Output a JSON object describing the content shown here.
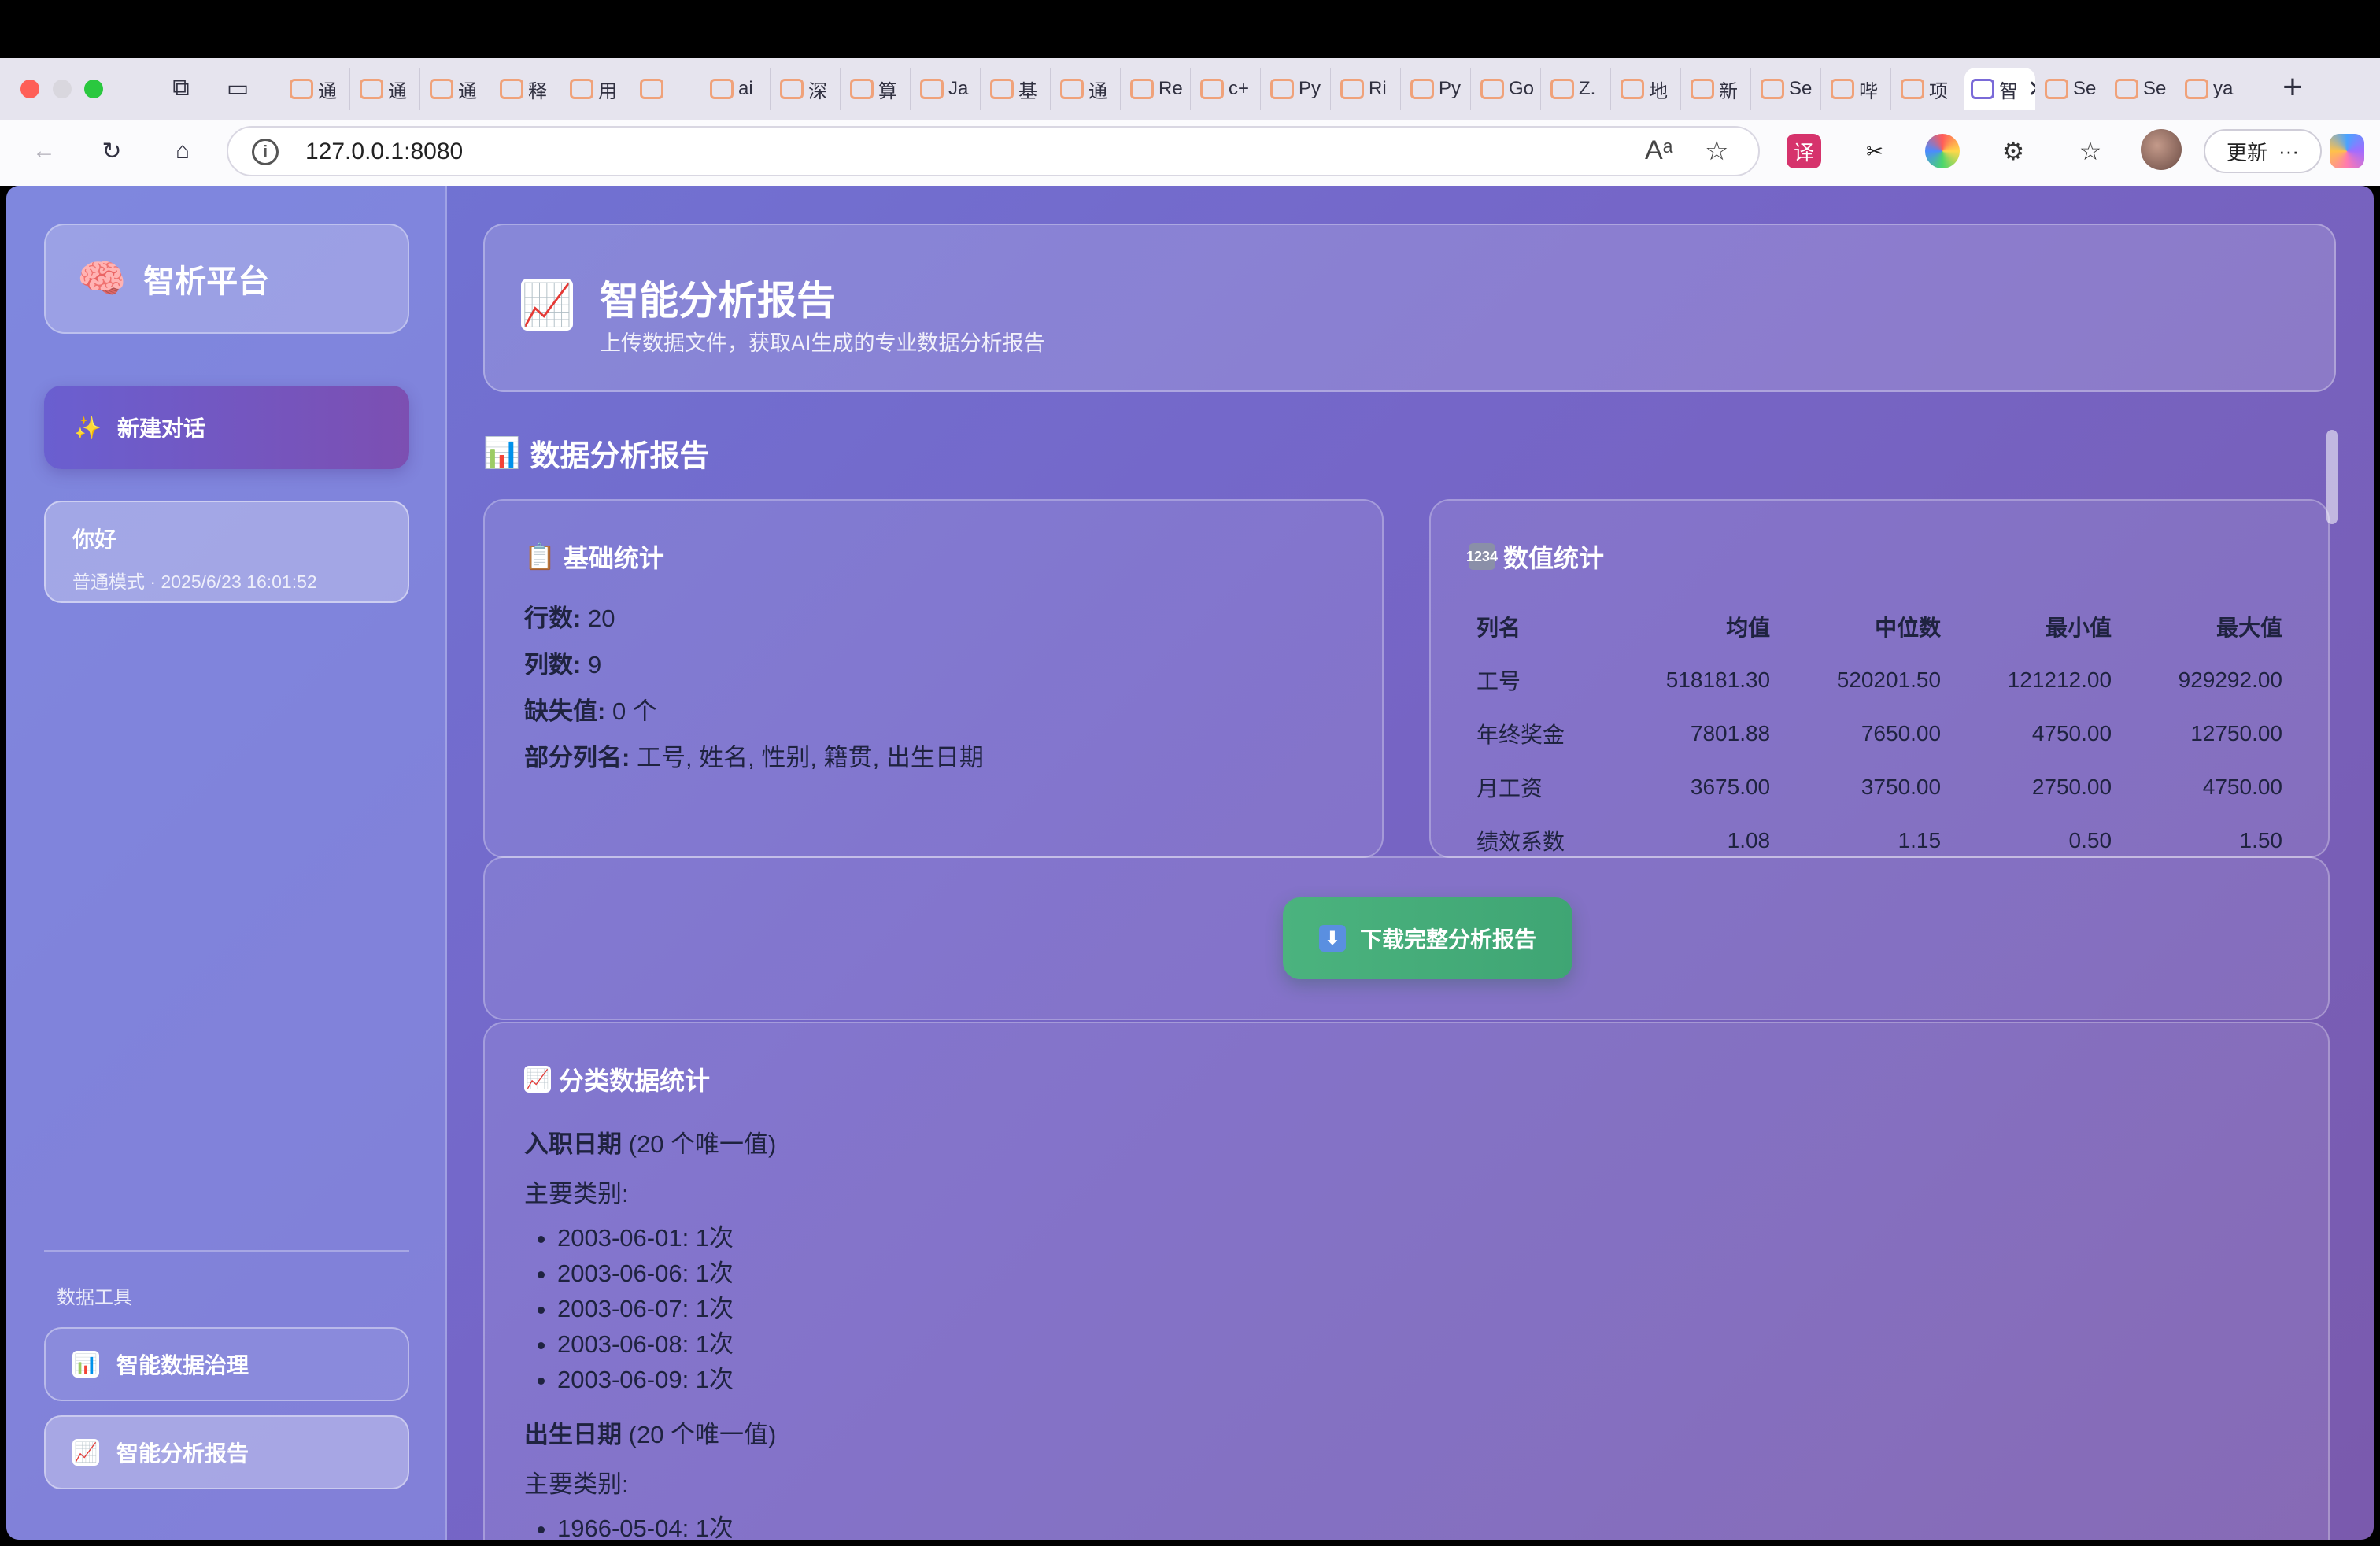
{
  "browser": {
    "tabs": [
      "通",
      "通",
      "通",
      "释",
      "用",
      "",
      "ai",
      "深",
      "算",
      "Ja",
      "基",
      "通",
      "Re",
      "c+",
      "Py",
      "Ri",
      "Py",
      "Go",
      "Z.",
      "地",
      "新",
      "Se",
      "哔",
      "项",
      "智",
      "Se",
      "Se",
      "ya"
    ],
    "active_tab_index": 24,
    "url": "127.0.0.1:8080",
    "update_label": "更新"
  },
  "sidebar": {
    "brand_icon": "brain-emoji",
    "brand_title": "智析平台",
    "new_chat_label": "新建对话",
    "conversations": [
      {
        "title": "你好",
        "meta": "普通模式 · 2025/6/23 16:01:52"
      }
    ],
    "tools_label": "数据工具",
    "tools": [
      {
        "label": "智能数据治理",
        "icon": "bar-chart-icon"
      },
      {
        "label": "智能分析报告",
        "icon": "trend-chart-icon"
      }
    ]
  },
  "header": {
    "title": "智能分析报告",
    "subtitle": "上传数据文件，获取AI生成的专业数据分析报告"
  },
  "report": {
    "section_title": "数据分析报告",
    "basic": {
      "title": "基础统计",
      "rows_label": "行数:",
      "rows_value": "20",
      "cols_label": "列数:",
      "cols_value": "9",
      "missing_label": "缺失值:",
      "missing_value": "0 个",
      "names_label": "部分列名:",
      "names_value": "工号, 姓名, 性别, 籍贯, 出生日期"
    },
    "numeric": {
      "title": "数值统计",
      "headers": [
        "列名",
        "均值",
        "中位数",
        "最小值",
        "最大值"
      ],
      "rows": [
        [
          "工号",
          "518181.30",
          "520201.50",
          "121212.00",
          "929292.00"
        ],
        [
          "年终奖金",
          "7801.88",
          "7650.00",
          "4750.00",
          "12750.00"
        ],
        [
          "月工资",
          "3675.00",
          "3750.00",
          "2750.00",
          "4750.00"
        ],
        [
          "绩效系数",
          "1.08",
          "1.15",
          "0.50",
          "1.50"
        ]
      ]
    },
    "download_label": "下载完整分析报告",
    "categorical": {
      "title": "分类数据统计",
      "groups": [
        {
          "name": "入职日期",
          "count_text": "(20 个唯一值)",
          "sub": "主要类别:",
          "items": [
            "2003-06-01: 1次",
            "2003-06-06: 1次",
            "2003-06-07: 1次",
            "2003-06-08: 1次",
            "2003-06-09: 1次"
          ]
        },
        {
          "name": "出生日期",
          "count_text": "(20 个唯一值)",
          "sub": "主要类别:",
          "items": [
            "1966-05-04: 1次"
          ]
        }
      ]
    }
  }
}
